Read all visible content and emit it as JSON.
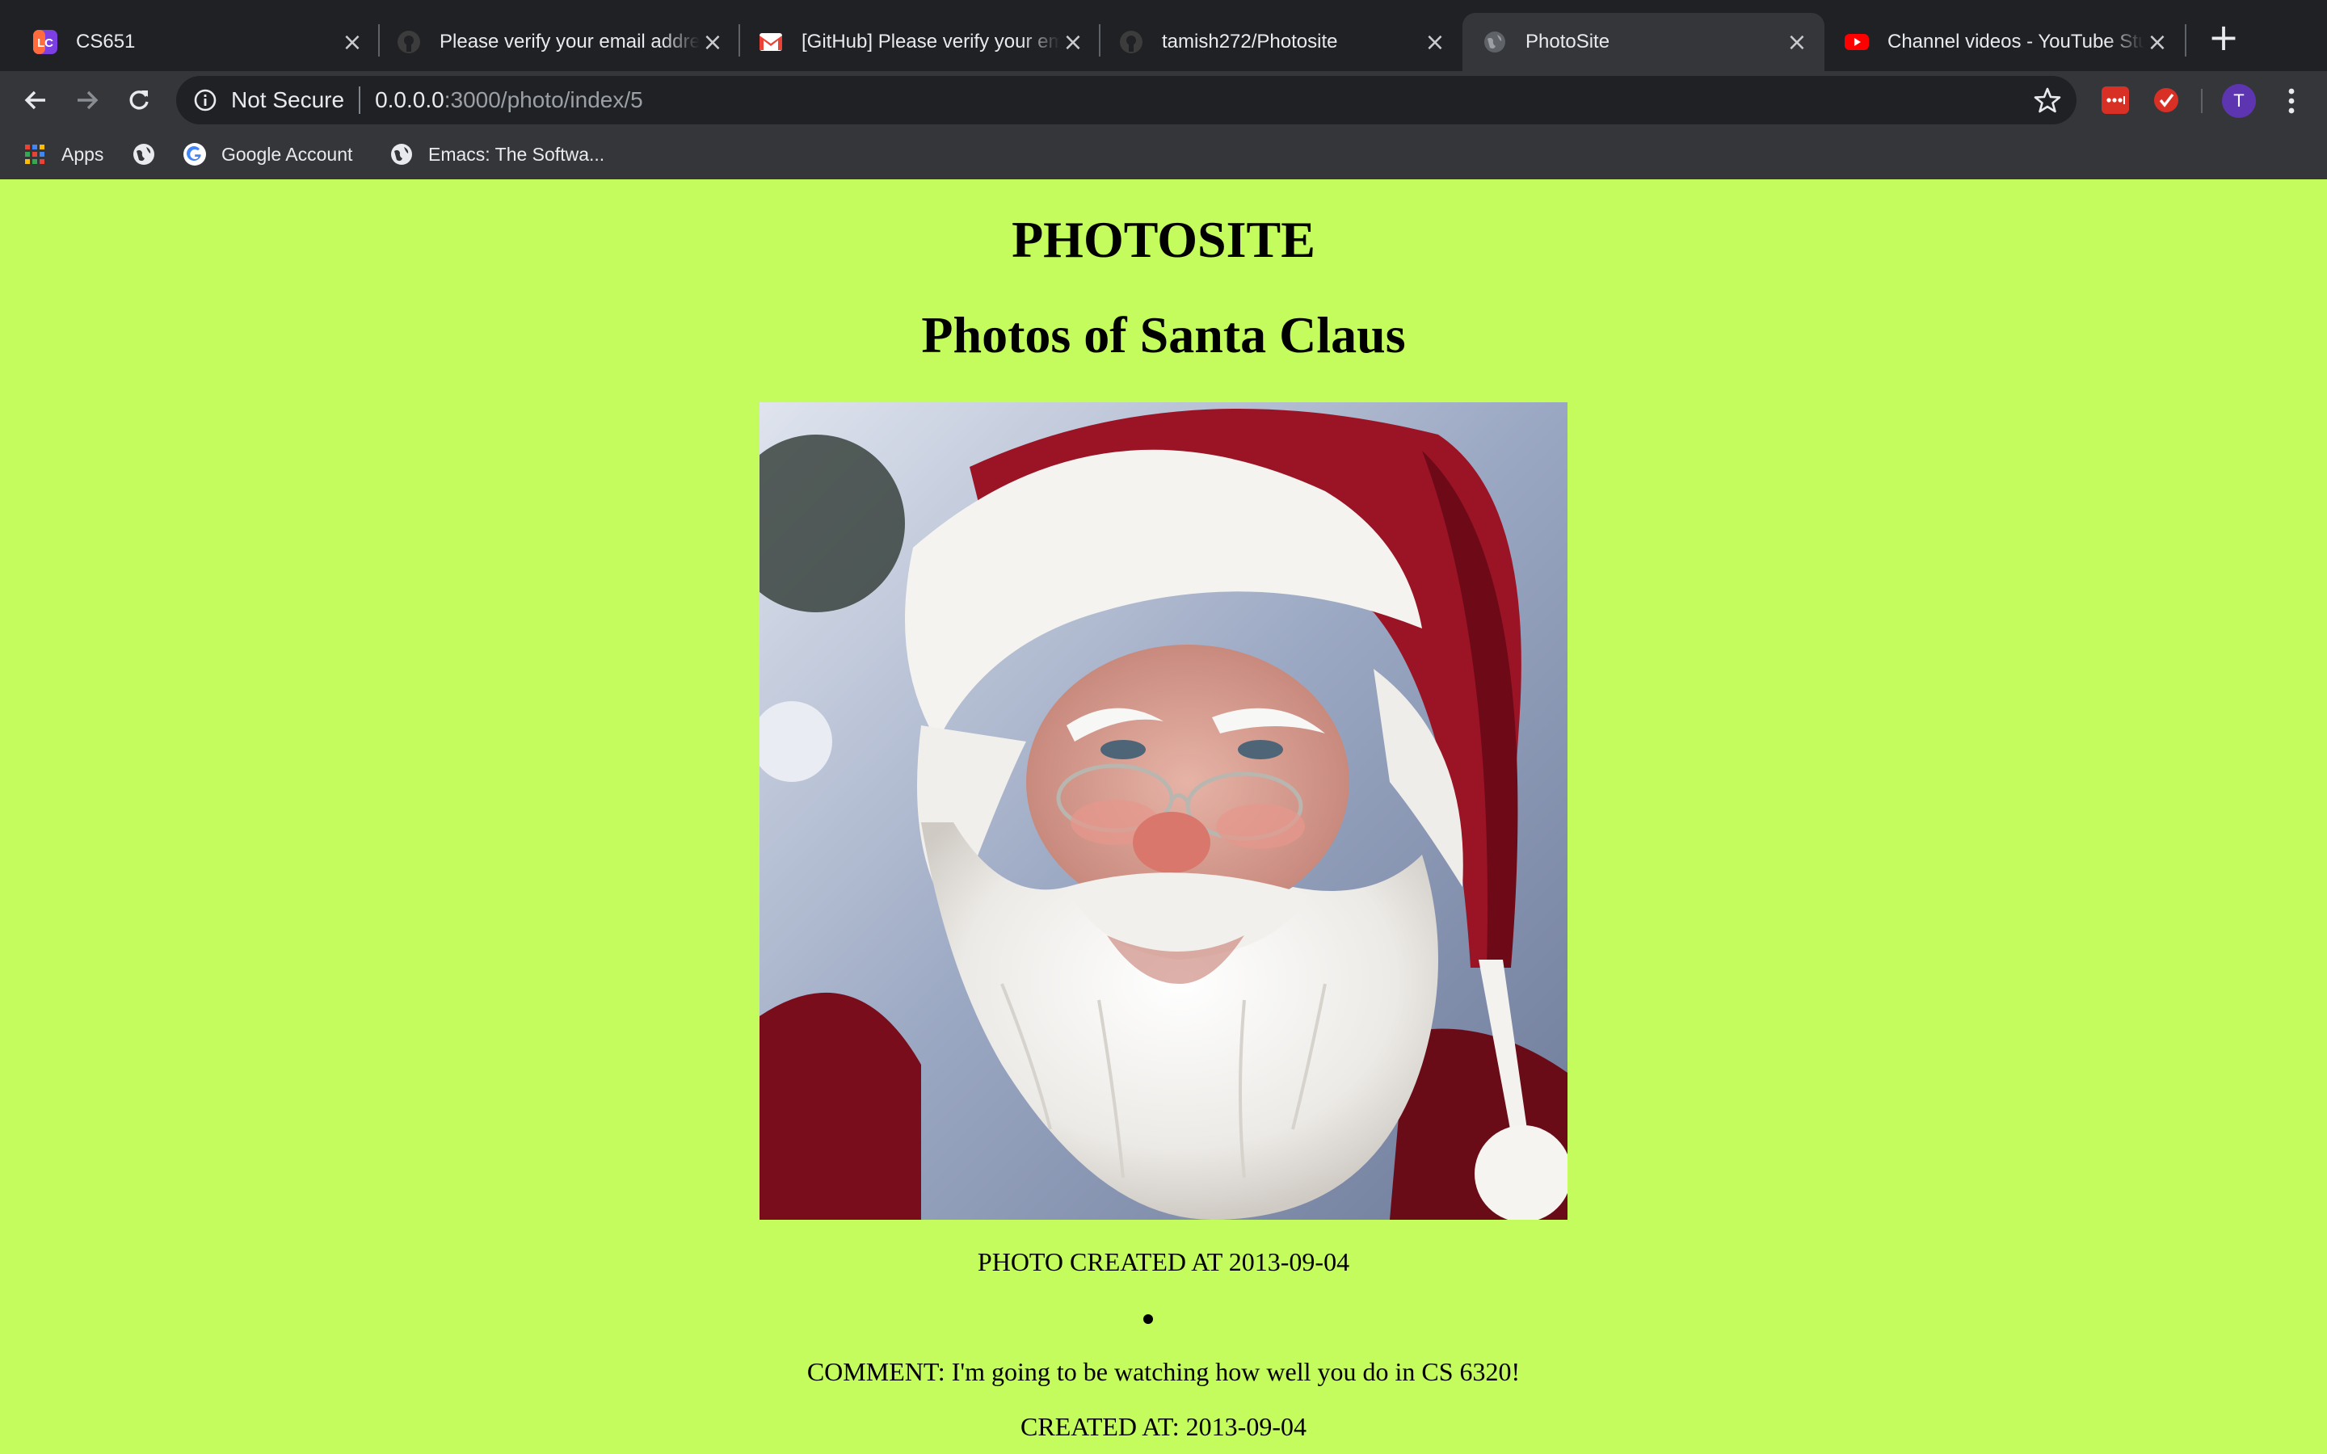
{
  "browser": {
    "tabs": [
      {
        "title": "CS651",
        "icon": "lc-app-icon"
      },
      {
        "title": "Please verify your email address",
        "icon": "github-icon"
      },
      {
        "title": "[GitHub] Please verify your email",
        "icon": "gmail-icon"
      },
      {
        "title": "tamish272/Photosite",
        "icon": "github-icon"
      },
      {
        "title": "PhotoSite",
        "icon": "globe-icon",
        "active": true
      },
      {
        "title": "Channel videos - YouTube Studio",
        "icon": "youtube-icon"
      }
    ],
    "address": {
      "security_label": "Not Secure",
      "host": "0.0.0.0",
      "path": ":3000/photo/index/5"
    },
    "profile_initial": "T",
    "bookmarks": [
      {
        "label": "Apps",
        "icon": "apps-grid-icon"
      },
      {
        "label": "",
        "icon": "globe-icon"
      },
      {
        "label": "Google Account",
        "icon": "google-icon"
      },
      {
        "label": "Emacs: The Softwa...",
        "icon": "globe-icon"
      }
    ]
  },
  "page": {
    "site_title": "PHOTOSITE",
    "heading": "Photos of Santa Claus",
    "photo_alt": "Santa Claus portrait",
    "photo_caption": "PHOTO CREATED AT 2013-09-04",
    "comments": [
      {
        "text": "COMMENT: I'm going to be watching how well you do in CS 6320!",
        "created": "CREATED AT: 2013-09-04"
      }
    ]
  },
  "colors": {
    "page_background": "#c3fc5c",
    "chrome_dark": "#202124",
    "chrome_toolbar": "#35363a"
  }
}
